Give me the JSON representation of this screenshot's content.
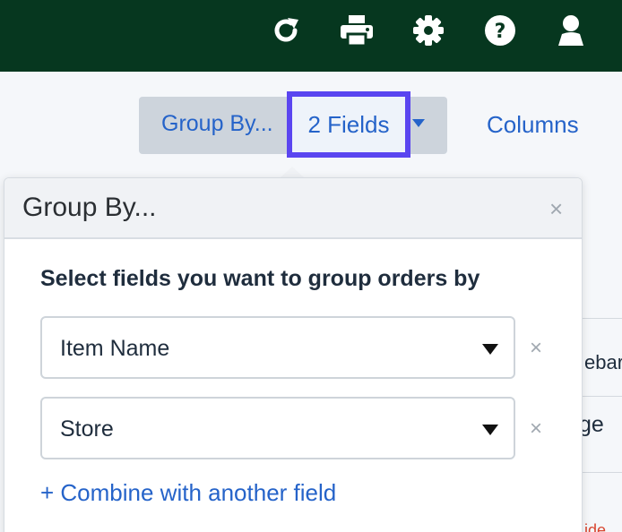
{
  "header": {
    "icons": [
      "refresh-icon",
      "print-icon",
      "gear-icon",
      "help-icon",
      "user-icon"
    ],
    "background_color": "#06371f"
  },
  "toolbar": {
    "group_by_label": "Group By...",
    "fields_count_label": "2 Fields",
    "columns_label": "Columns",
    "accent_color": "#2563c9",
    "highlight_color": "#5a45f0"
  },
  "background_table": {
    "cells": [
      "ebar",
      "ge",
      "ide"
    ]
  },
  "popover": {
    "title": "Group By...",
    "close_symbol": "×",
    "instruction": "Select fields you want to group orders by",
    "fields": [
      {
        "value": "Item Name",
        "remove_symbol": "×"
      },
      {
        "value": "Store",
        "remove_symbol": "×"
      }
    ],
    "add_link": "+ Combine with another field"
  }
}
